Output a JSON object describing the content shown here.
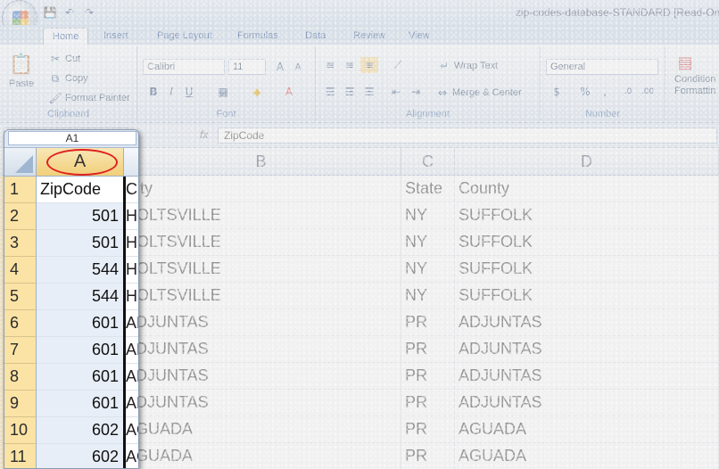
{
  "window": {
    "title": "zip-codes-database-STANDARD  [Read-On"
  },
  "quick_access": [
    {
      "icon": "save-icon",
      "glyph": "💾"
    },
    {
      "icon": "undo-icon",
      "glyph": "↶"
    },
    {
      "icon": "redo-icon",
      "glyph": "↷"
    }
  ],
  "tabs": [
    "Home",
    "Insert",
    "Page Layout",
    "Formulas",
    "Data",
    "Review",
    "View"
  ],
  "ribbon": {
    "clipboard": {
      "paste": "Paste",
      "cut": "Cut",
      "copy": "Copy",
      "format_painter": "Format Painter",
      "label": "Clipboard"
    },
    "font": {
      "font_name": "Calibri",
      "font_size": "11",
      "label": "Font"
    },
    "alignment": {
      "wrap_text": "Wrap Text",
      "merge_center": "Merge & Center",
      "label": "Alignment"
    },
    "number": {
      "format": "General",
      "label": "Number"
    },
    "styles": {
      "conditional": "Condition",
      "formatting": "Formattin"
    }
  },
  "formula_bar": {
    "name_box": "A1",
    "fx": "fx",
    "formula": "ZipCode"
  },
  "columns": [
    "A",
    "B",
    "C",
    "D"
  ],
  "rows": [
    {
      "n": "1",
      "zip": "ZipCode",
      "city": "City",
      "state": "State",
      "county": "County"
    },
    {
      "n": "2",
      "zip": "501",
      "city": "HOLTSVILLE",
      "state": "NY",
      "county": "SUFFOLK"
    },
    {
      "n": "3",
      "zip": "501",
      "city": "HOLTSVILLE",
      "state": "NY",
      "county": "SUFFOLK"
    },
    {
      "n": "4",
      "zip": "544",
      "city": "HOLTSVILLE",
      "state": "NY",
      "county": "SUFFOLK"
    },
    {
      "n": "5",
      "zip": "544",
      "city": "HOLTSVILLE",
      "state": "NY",
      "county": "SUFFOLK"
    },
    {
      "n": "6",
      "zip": "601",
      "city": "ADJUNTAS",
      "state": "PR",
      "county": "ADJUNTAS"
    },
    {
      "n": "7",
      "zip": "601",
      "city": "ADJUNTAS",
      "state": "PR",
      "county": "ADJUNTAS"
    },
    {
      "n": "8",
      "zip": "601",
      "city": "ADJUNTAS",
      "state": "PR",
      "county": "ADJUNTAS"
    },
    {
      "n": "9",
      "zip": "601",
      "city": "ADJUNTAS",
      "state": "PR",
      "county": "ADJUNTAS"
    },
    {
      "n": "10",
      "zip": "602",
      "city": "AGUADA",
      "state": "PR",
      "county": "AGUADA"
    },
    {
      "n": "11",
      "zip": "602",
      "city": "AGUADA",
      "state": "PR",
      "county": "AGUADA"
    }
  ],
  "colors": {
    "row_header": "#fbe3a5",
    "highlight_circle": "#e0201e"
  }
}
